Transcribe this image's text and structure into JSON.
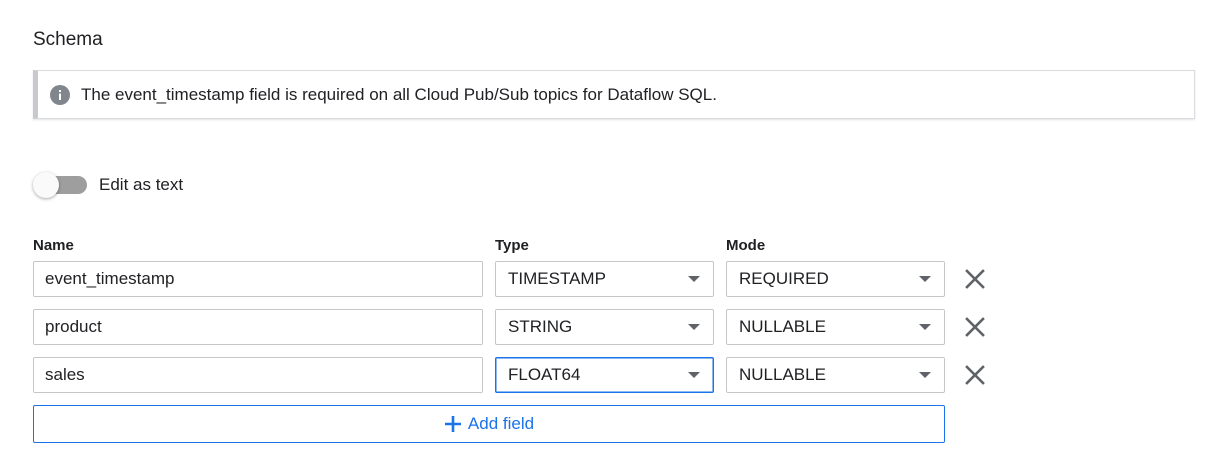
{
  "section": {
    "title": "Schema"
  },
  "notice": {
    "icon": "info-icon",
    "text": "The event_timestamp field is required on all Cloud Pub/Sub topics for Dataflow SQL."
  },
  "edit_as_text": {
    "label": "Edit as text",
    "enabled": false
  },
  "columns": {
    "name": "Name",
    "type": "Type",
    "mode": "Mode"
  },
  "fields": [
    {
      "name": "event_timestamp",
      "type": "TIMESTAMP",
      "mode": "REQUIRED"
    },
    {
      "name": "product",
      "type": "STRING",
      "mode": "NULLABLE"
    },
    {
      "name": "sales",
      "type": "FLOAT64",
      "mode": "NULLABLE"
    }
  ],
  "add_field": {
    "label": "Add field"
  },
  "colors": {
    "accent": "#1a73e8",
    "text": "#202124",
    "icon_gray": "#5f6368"
  }
}
